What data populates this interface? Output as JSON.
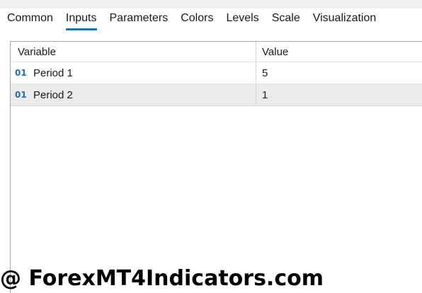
{
  "tabs": [
    {
      "label": "Common",
      "active": false
    },
    {
      "label": "Inputs",
      "active": true
    },
    {
      "label": "Parameters",
      "active": false
    },
    {
      "label": "Colors",
      "active": false
    },
    {
      "label": "Levels",
      "active": false
    },
    {
      "label": "Scale",
      "active": false
    },
    {
      "label": "Visualization",
      "active": false
    }
  ],
  "table": {
    "headers": {
      "variable": "Variable",
      "value": "Value"
    },
    "rows": [
      {
        "type_icon": "01",
        "variable": "Period 1",
        "value": "5"
      },
      {
        "type_icon": "01",
        "variable": "Period 2",
        "value": "1"
      }
    ],
    "selected_row": 1
  },
  "watermark": "@ ForexMT4Indicators.com",
  "colors": {
    "accent": "#1f6fae",
    "selected_row_bg": "#ebebeb",
    "border": "#a9a9a9"
  }
}
